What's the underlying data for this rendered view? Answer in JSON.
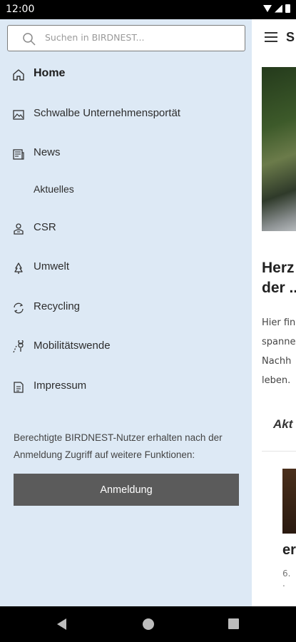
{
  "status_bar": {
    "time": "12:00"
  },
  "app": {
    "brand": "S",
    "heading_line1": "Herz",
    "heading_line2": "der ..",
    "text_lines": [
      "Hier fin",
      "spanne",
      "Nachh",
      "leben."
    ],
    "tab_label": "Akt",
    "card_title": "er",
    "card_date": "6. ."
  },
  "drawer": {
    "search_placeholder": "Suchen in BIRDNEST...",
    "items": [
      {
        "label": "Home",
        "icon": "home-icon"
      },
      {
        "label": "Schwalbe Unternehmensportät",
        "icon": "image-icon"
      },
      {
        "label": "News",
        "icon": "news-icon"
      },
      {
        "label": "Aktuelles",
        "icon": ""
      },
      {
        "label": "CSR",
        "icon": "person-icon"
      },
      {
        "label": "Umwelt",
        "icon": "tree-icon"
      },
      {
        "label": "Recycling",
        "icon": "recycle-icon"
      },
      {
        "label": "Mobilitätswende",
        "icon": "route-icon"
      },
      {
        "label": "Impressum",
        "icon": "document-icon"
      }
    ],
    "info_text": "Berechtigte BIRDNEST-Nutzer erhalten nach der Anmeldung Zugriff auf weitere Funktionen:",
    "login_label": "Anmeldung"
  }
}
